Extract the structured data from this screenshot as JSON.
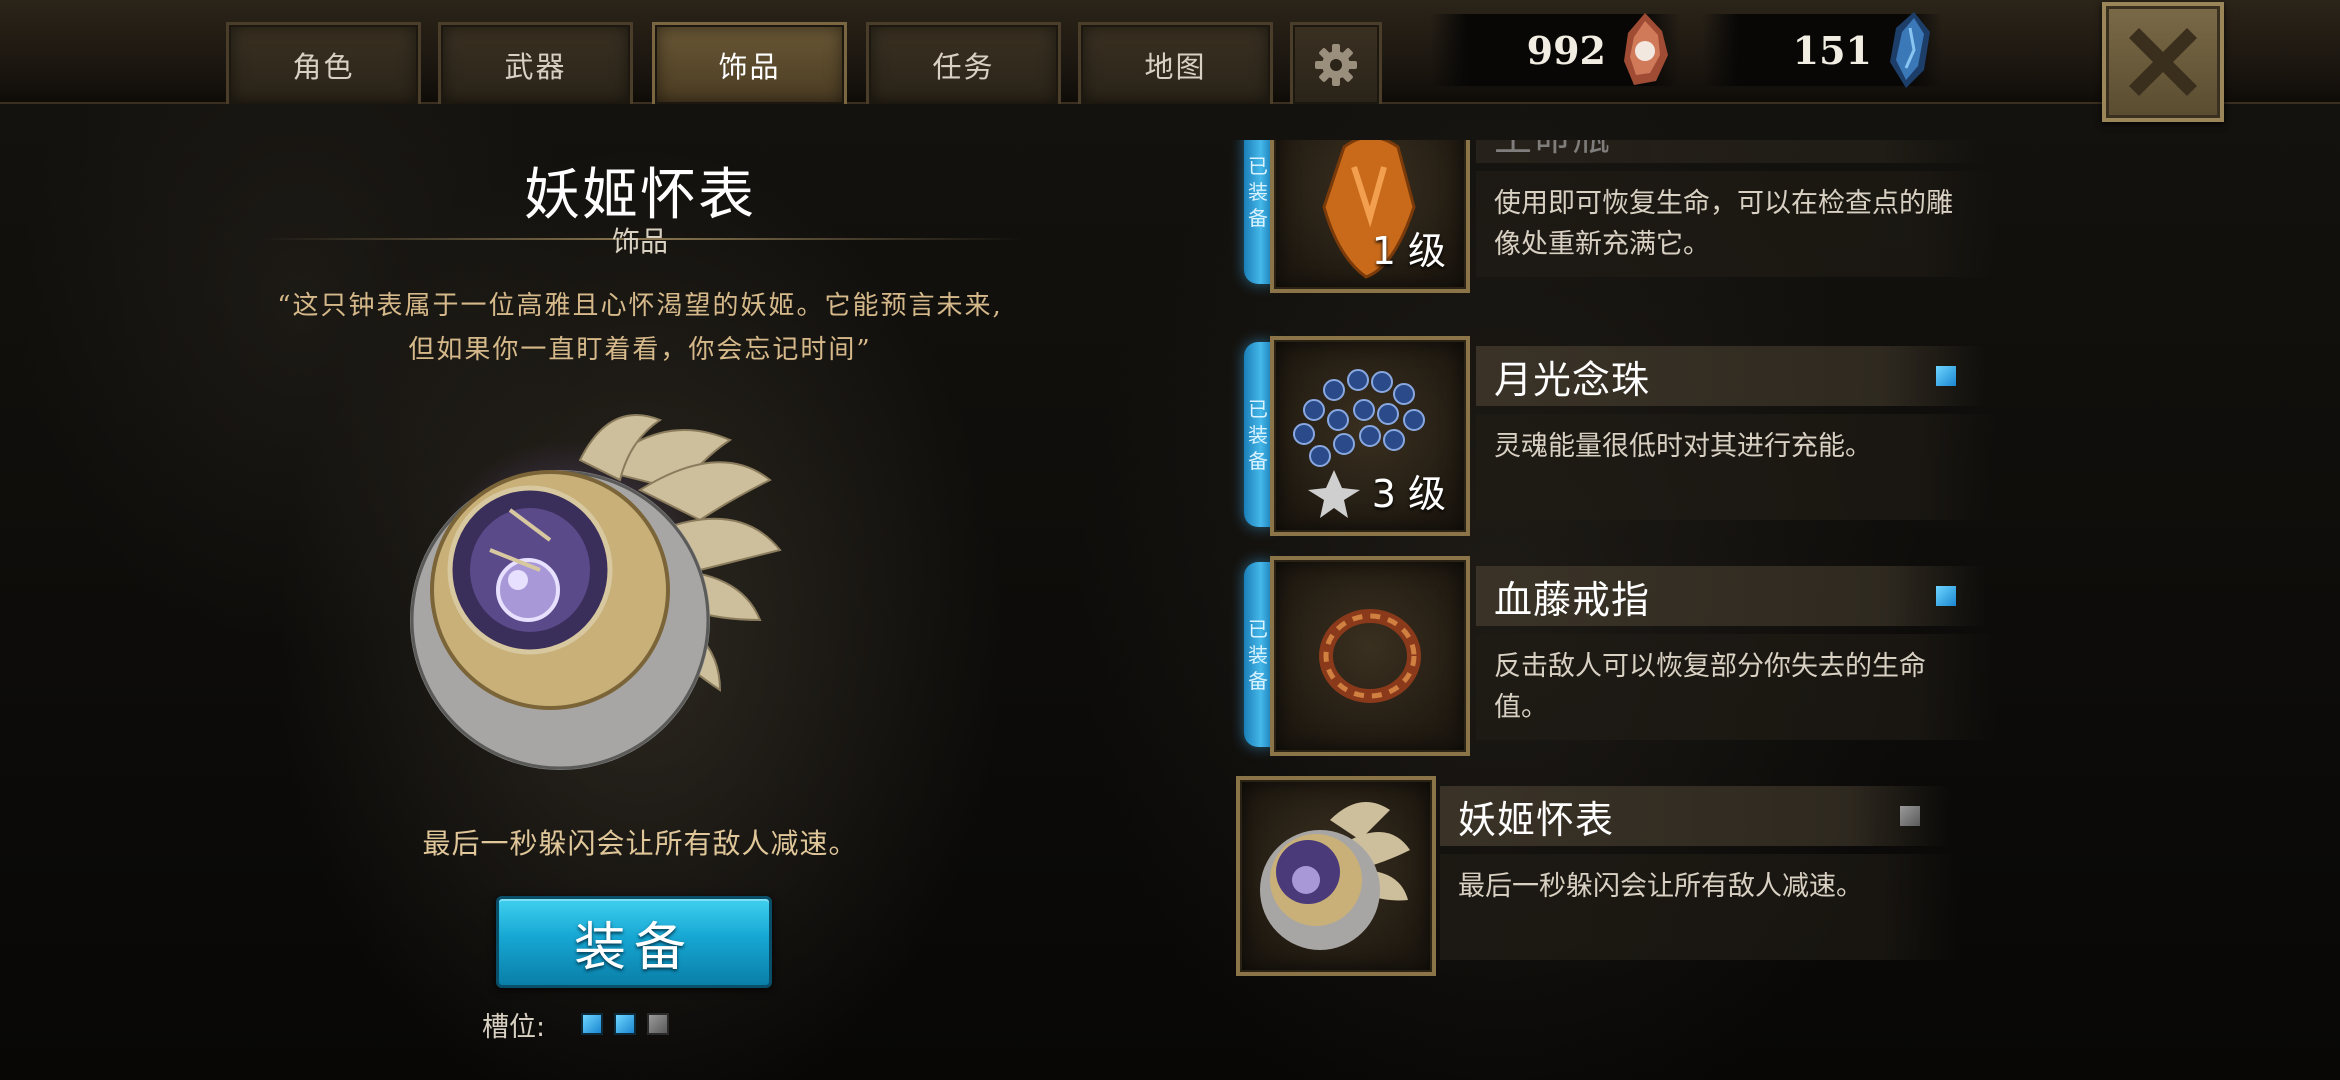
{
  "tabs": [
    {
      "label": "角色",
      "active": false
    },
    {
      "label": "武器",
      "active": false
    },
    {
      "label": "饰品",
      "active": true
    },
    {
      "label": "任务",
      "active": false
    },
    {
      "label": "地图",
      "active": false
    }
  ],
  "settings_icon": "gear-icon",
  "currencies": [
    {
      "value": "992",
      "icon": "soul-shard-icon",
      "color": "#c86a4a"
    },
    {
      "value": "151",
      "icon": "blue-crystal-icon",
      "color": "#3a7ac8"
    }
  ],
  "close_icon": "close-icon",
  "detail": {
    "title": "妖姬怀表",
    "category": "饰品",
    "quote_line1": "“这只钟表属于一位高雅且心怀渴望的妖姬。它能预言未来,",
    "quote_line2": "但如果你一直盯着看，你会忘记时间”",
    "effect": "最后一秒躲闪会让所有敌人减速。",
    "equip_label": "装备",
    "slots_label": "槽位:",
    "slots": [
      "filled",
      "filled",
      "empty"
    ]
  },
  "items": [
    {
      "name": "生命瓶",
      "desc": "使用即可恢复生命，可以在检查点的雕像处重新充满它。",
      "level": "1 级",
      "equipped": true,
      "equipped_label": [
        "已",
        "装",
        "备"
      ],
      "indicator": "none",
      "icon": "life-flask-icon"
    },
    {
      "name": "月光念珠",
      "desc": "灵魂能量很低时对其进行充能。",
      "level": "3 级",
      "equipped": true,
      "equipped_label": [
        "已",
        "装",
        "备"
      ],
      "indicator": "blue",
      "icon": "moonlight-beads-icon"
    },
    {
      "name": "血藤戒指",
      "desc": "反击敌人可以恢复部分你失去的生命值。",
      "level": "",
      "equipped": true,
      "equipped_label": [
        "已",
        "装",
        "备"
      ],
      "indicator": "blue",
      "icon": "blood-vine-ring-icon"
    },
    {
      "name": "妖姬怀表",
      "desc": "最后一秒躲闪会让所有敌人减速。",
      "level": "",
      "equipped": false,
      "indicator": "gray",
      "icon": "siren-pocketwatch-icon"
    }
  ]
}
